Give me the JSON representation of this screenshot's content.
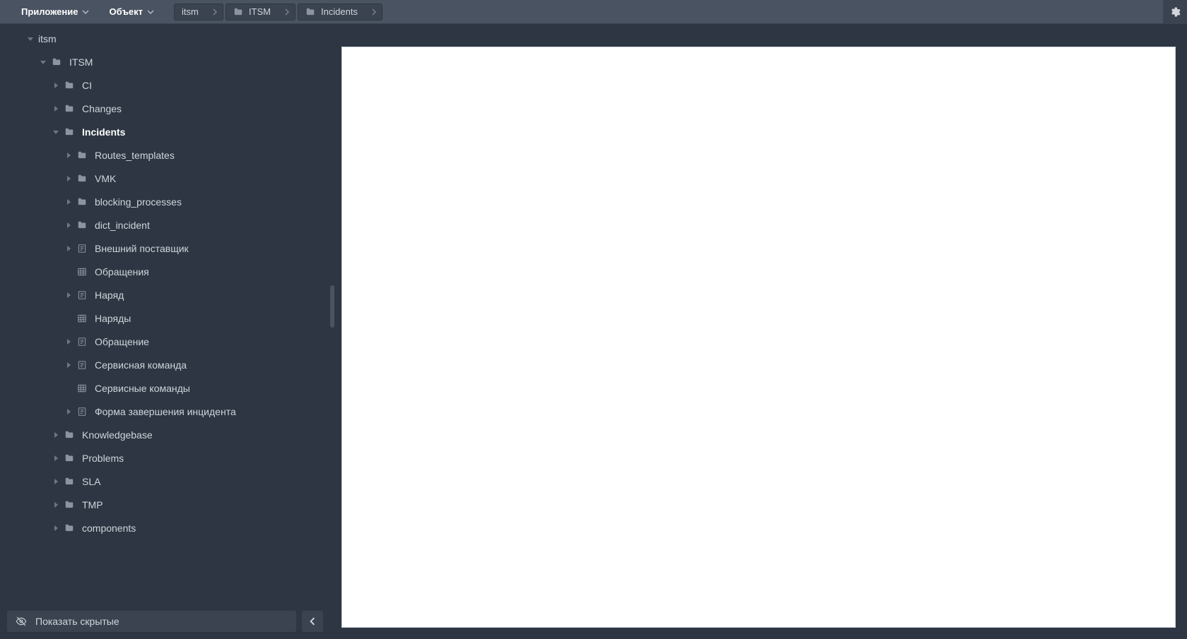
{
  "topbar": {
    "menu": {
      "app_label": "Приложение",
      "obj_label": "Объект"
    },
    "breadcrumbs": [
      {
        "label": "itsm",
        "icon": "none"
      },
      {
        "label": "ITSM",
        "icon": "folder"
      },
      {
        "label": "Incidents",
        "icon": "folder"
      }
    ]
  },
  "tree": [
    {
      "depth": 0,
      "expanded": true,
      "icon": "none",
      "label": "itsm",
      "selected": false
    },
    {
      "depth": 1,
      "expanded": true,
      "icon": "folder",
      "label": "ITSM",
      "selected": false
    },
    {
      "depth": 2,
      "expanded": false,
      "icon": "folder",
      "label": "CI",
      "selected": false
    },
    {
      "depth": 2,
      "expanded": false,
      "icon": "folder",
      "label": "Changes",
      "selected": false
    },
    {
      "depth": 2,
      "expanded": true,
      "icon": "folder",
      "label": "Incidents",
      "selected": true
    },
    {
      "depth": 3,
      "expanded": false,
      "icon": "folder",
      "label": "Routes_templates",
      "selected": false
    },
    {
      "depth": 3,
      "expanded": false,
      "icon": "folder",
      "label": "VMK",
      "selected": false
    },
    {
      "depth": 3,
      "expanded": false,
      "icon": "folder",
      "label": "blocking_processes",
      "selected": false
    },
    {
      "depth": 3,
      "expanded": false,
      "icon": "folder",
      "label": "dict_incident",
      "selected": false
    },
    {
      "depth": 3,
      "expanded": false,
      "icon": "form",
      "label": "Внешний поставщик",
      "selected": false
    },
    {
      "depth": 3,
      "expanded": null,
      "icon": "table",
      "label": "Обращения",
      "selected": false
    },
    {
      "depth": 3,
      "expanded": false,
      "icon": "form",
      "label": "Наряд",
      "selected": false
    },
    {
      "depth": 3,
      "expanded": null,
      "icon": "table",
      "label": "Наряды",
      "selected": false
    },
    {
      "depth": 3,
      "expanded": false,
      "icon": "form",
      "label": "Обращение",
      "selected": false
    },
    {
      "depth": 3,
      "expanded": false,
      "icon": "form",
      "label": "Сервисная команда",
      "selected": false
    },
    {
      "depth": 3,
      "expanded": null,
      "icon": "table",
      "label": "Сервисные команды",
      "selected": false
    },
    {
      "depth": 3,
      "expanded": false,
      "icon": "form",
      "label": "Форма завершения инцидента",
      "selected": false
    },
    {
      "depth": 2,
      "expanded": false,
      "icon": "folder",
      "label": "Knowledgebase",
      "selected": false
    },
    {
      "depth": 2,
      "expanded": false,
      "icon": "folder",
      "label": "Problems",
      "selected": false
    },
    {
      "depth": 2,
      "expanded": false,
      "icon": "folder",
      "label": "SLA",
      "selected": false
    },
    {
      "depth": 2,
      "expanded": false,
      "icon": "folder",
      "label": "TMP",
      "selected": false
    },
    {
      "depth": 2,
      "expanded": false,
      "icon": "folder",
      "label": "components",
      "selected": false
    }
  ],
  "footer": {
    "show_hidden_label": "Показать скрытые"
  }
}
